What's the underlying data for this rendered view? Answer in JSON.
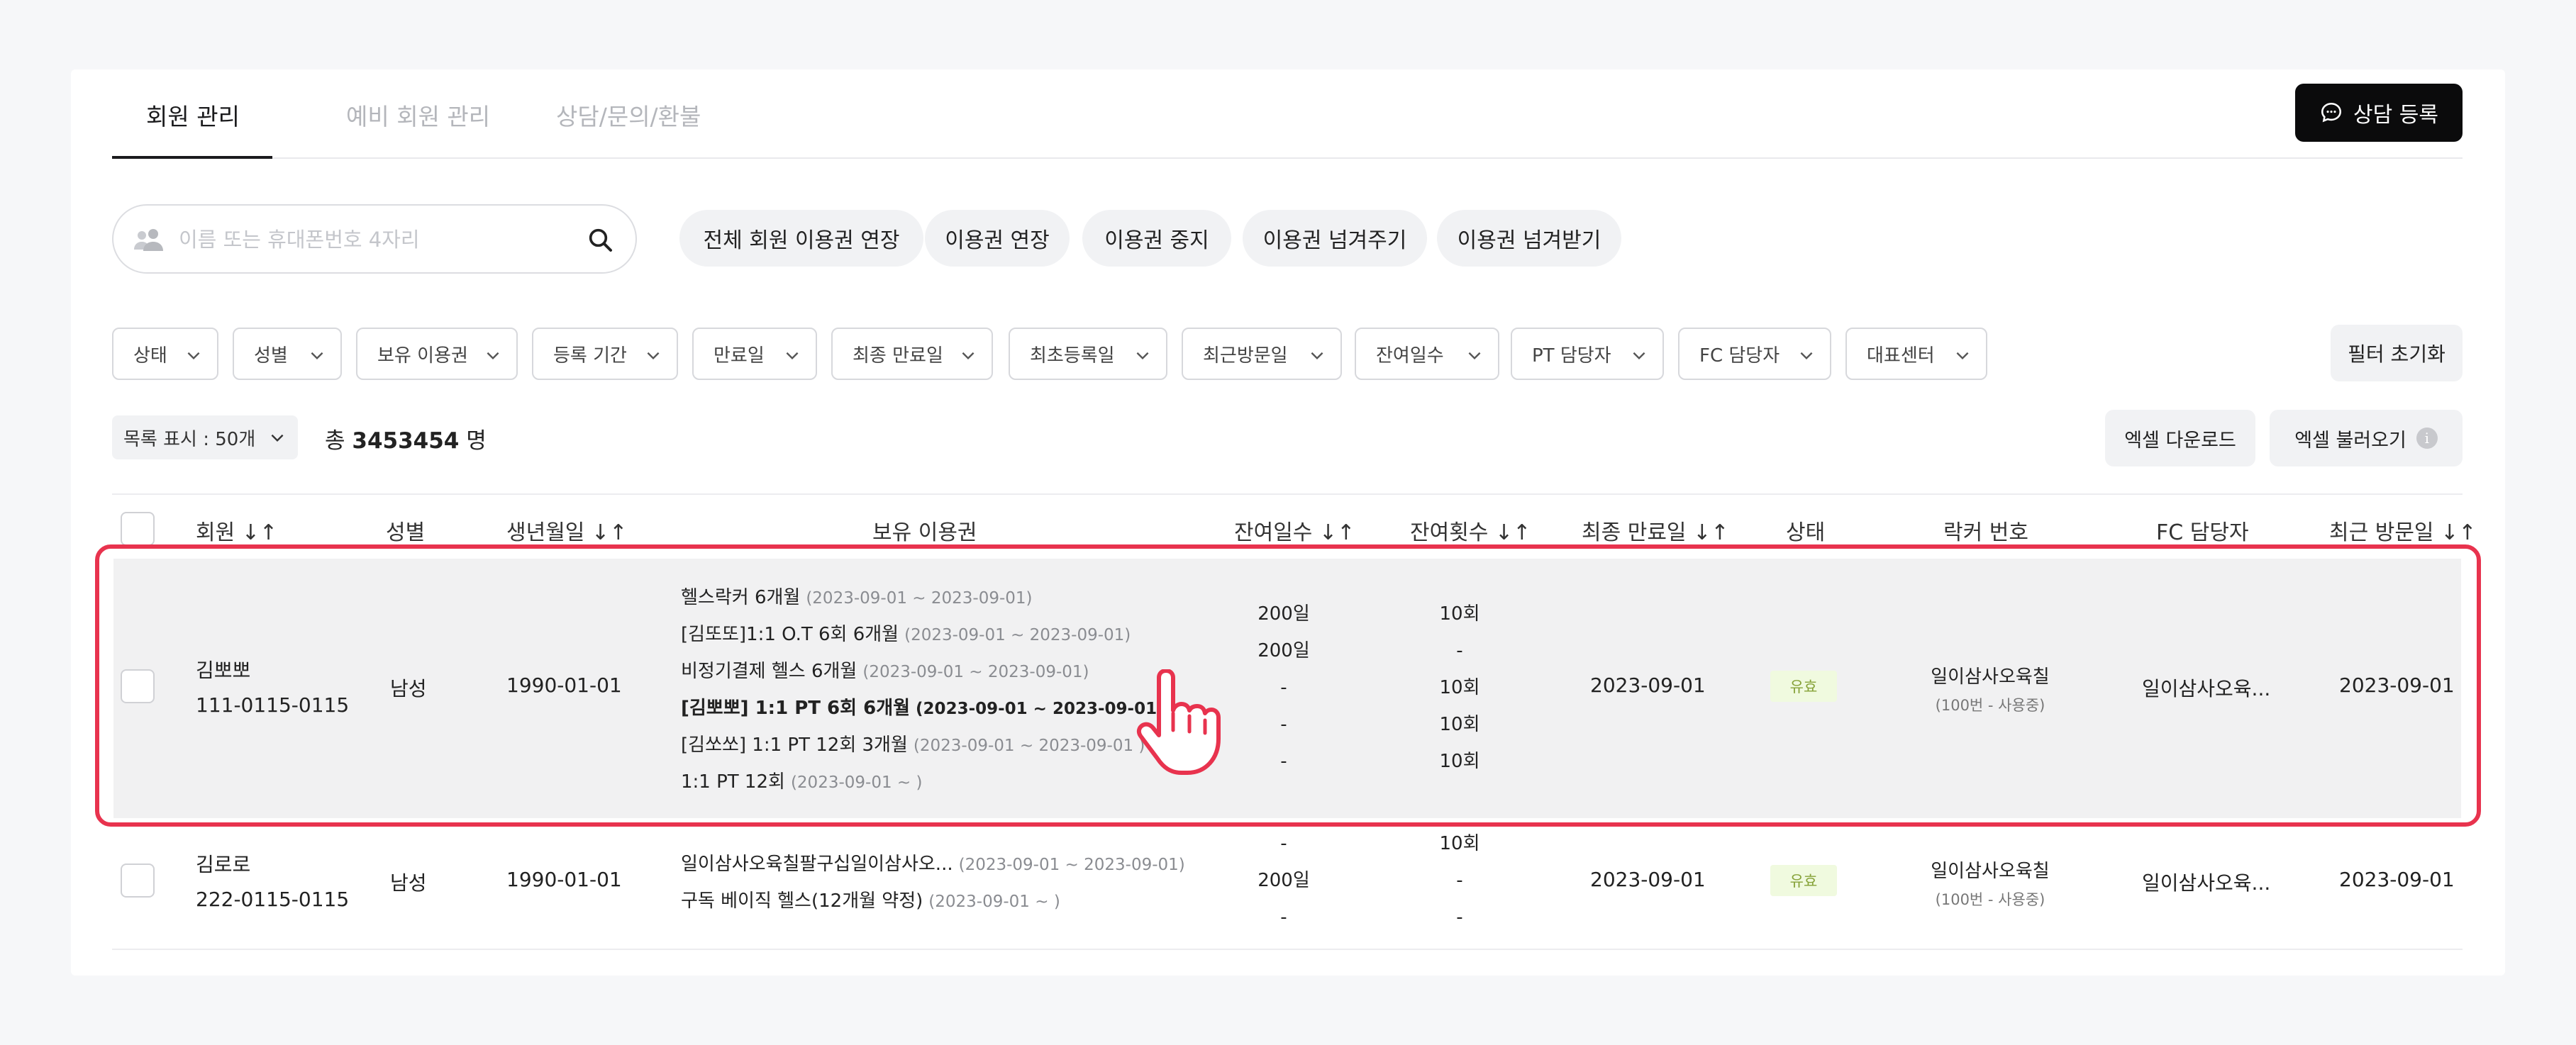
{
  "tabs": {
    "members": "회원 관리",
    "prospects": "예비 회원 관리",
    "consult": "상담/문의/환불"
  },
  "consult_button": "상담 등록",
  "search": {
    "placeholder": "이름 또는 휴대폰번호 4자리"
  },
  "actions": [
    "전체 회원 이용권 연장",
    "이용권 연장",
    "이용권 중지",
    "이용권 넘겨주기",
    "이용권 넘겨받기"
  ],
  "filters": [
    "상태",
    "성별",
    "보유 이용권",
    "등록 기간",
    "만료일",
    "최종 만료일",
    "최초등록일",
    "최근방문일",
    "잔여일수",
    "PT 담당자",
    "FC 담당자",
    "대표센터"
  ],
  "filter_reset": "필터 초기화",
  "list": {
    "page_size": "목록 표시 : 50개",
    "total_prefix": "총",
    "total_count": "3453454",
    "total_suffix": "명",
    "excel_download": "엑셀 다운로드",
    "excel_import": "엑셀 불러오기"
  },
  "columns": {
    "member": "회원 ↓↑",
    "gender": "성별",
    "birth": "생년월일 ↓↑",
    "passes": "보유 이용권",
    "days_left": "잔여일수 ↓↑",
    "count_left": "잔여횟수 ↓↑",
    "final_expiry": "최종 만료일 ↓↑",
    "status": "상태",
    "locker": "락커 번호",
    "fc": "FC 담당자",
    "last_visit": "최근 방문일 ↓↑"
  },
  "rows": [
    {
      "name": "김뽀뽀",
      "phone": "111-0115-0115",
      "gender": "남성",
      "birth": "1990-01-01",
      "passes": [
        {
          "name": "헬스락커 6개월",
          "period": "(2023-09-01 ~ 2023-09-01)"
        },
        {
          "name": "[김또또]1:1 O.T 6회 6개월",
          "period": "(2023-09-01 ~ 2023-09-01)"
        },
        {
          "name": "비정기결제 헬스 6개월",
          "period": "(2023-09-01 ~ 2023-09-01)"
        },
        {
          "name": "[김뽀뽀] 1:1 PT 6회 6개월",
          "period": "(2023-09-01 ~ 2023-09-01 )"
        },
        {
          "name": "[김쏘쏘] 1:1 PT 12회 3개월",
          "period": "(2023-09-01 ~ 2023-09-01 )"
        },
        {
          "name": "1:1 PT 12회",
          "period": "(2023-09-01 ~ )"
        }
      ],
      "days_left": [
        "200일",
        "200일",
        "-",
        "-",
        "-"
      ],
      "count_left": [
        "10회",
        "-",
        "10회",
        "10회",
        "10회"
      ],
      "final_expiry": "2023-09-01",
      "status": "유효",
      "locker_name": "일이삼사오육칠",
      "locker_sub": "(100번 - 사용중)",
      "fc": "일이삼사오육...",
      "last_visit": "2023-09-01"
    },
    {
      "name": "김로로",
      "phone": "222-0115-0115",
      "gender": "남성",
      "birth": "1990-01-01",
      "passes": [
        {
          "name": "일이삼사오육칠팔구십일이삼사오...",
          "period": "(2023-09-01 ~ 2023-09-01)"
        },
        {
          "name": "구독 베이직 헬스(12개월 약정)",
          "period": "(2023-09-01 ~ )"
        }
      ],
      "days_left": [
        "-",
        "200일",
        "-"
      ],
      "count_left": [
        "10회",
        "-",
        "-"
      ],
      "final_expiry": "2023-09-01",
      "status": "유효",
      "locker_name": "일이삼사오육칠",
      "locker_sub": "(100번 - 사용중)",
      "fc": "일이삼사오육...",
      "last_visit": "2023-09-01"
    }
  ],
  "colors": {
    "accent_dark": "#0b0b0c",
    "highlight": "#e8334e",
    "status_badge_bg": "#f0fadf",
    "status_badge_text": "#86a238"
  }
}
